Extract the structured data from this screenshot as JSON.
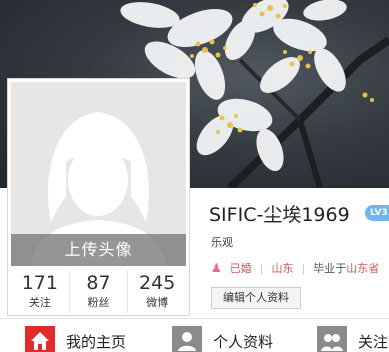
{
  "profile": {
    "upload_label": "上传头像",
    "username": "SIFIC-尘埃1969",
    "vip_badge": "LV3",
    "tagline": "乐观",
    "marital_status": "已婚",
    "region": "山东",
    "education_prefix": "毕业于",
    "education_school": "山东省",
    "edit_button": "编辑个人资料"
  },
  "stats": [
    {
      "value": "171",
      "label": "关注"
    },
    {
      "value": "87",
      "label": "粉丝"
    },
    {
      "value": "245",
      "label": "微博"
    }
  ],
  "nav": {
    "home": "我的主页",
    "profile": "个人资料",
    "follow": "关注"
  },
  "colors": {
    "accent_red": "#e02b2b",
    "link_red": "#c85b5b",
    "gender_pink": "#e8679d",
    "vip_blue": "#6fb5ec"
  }
}
